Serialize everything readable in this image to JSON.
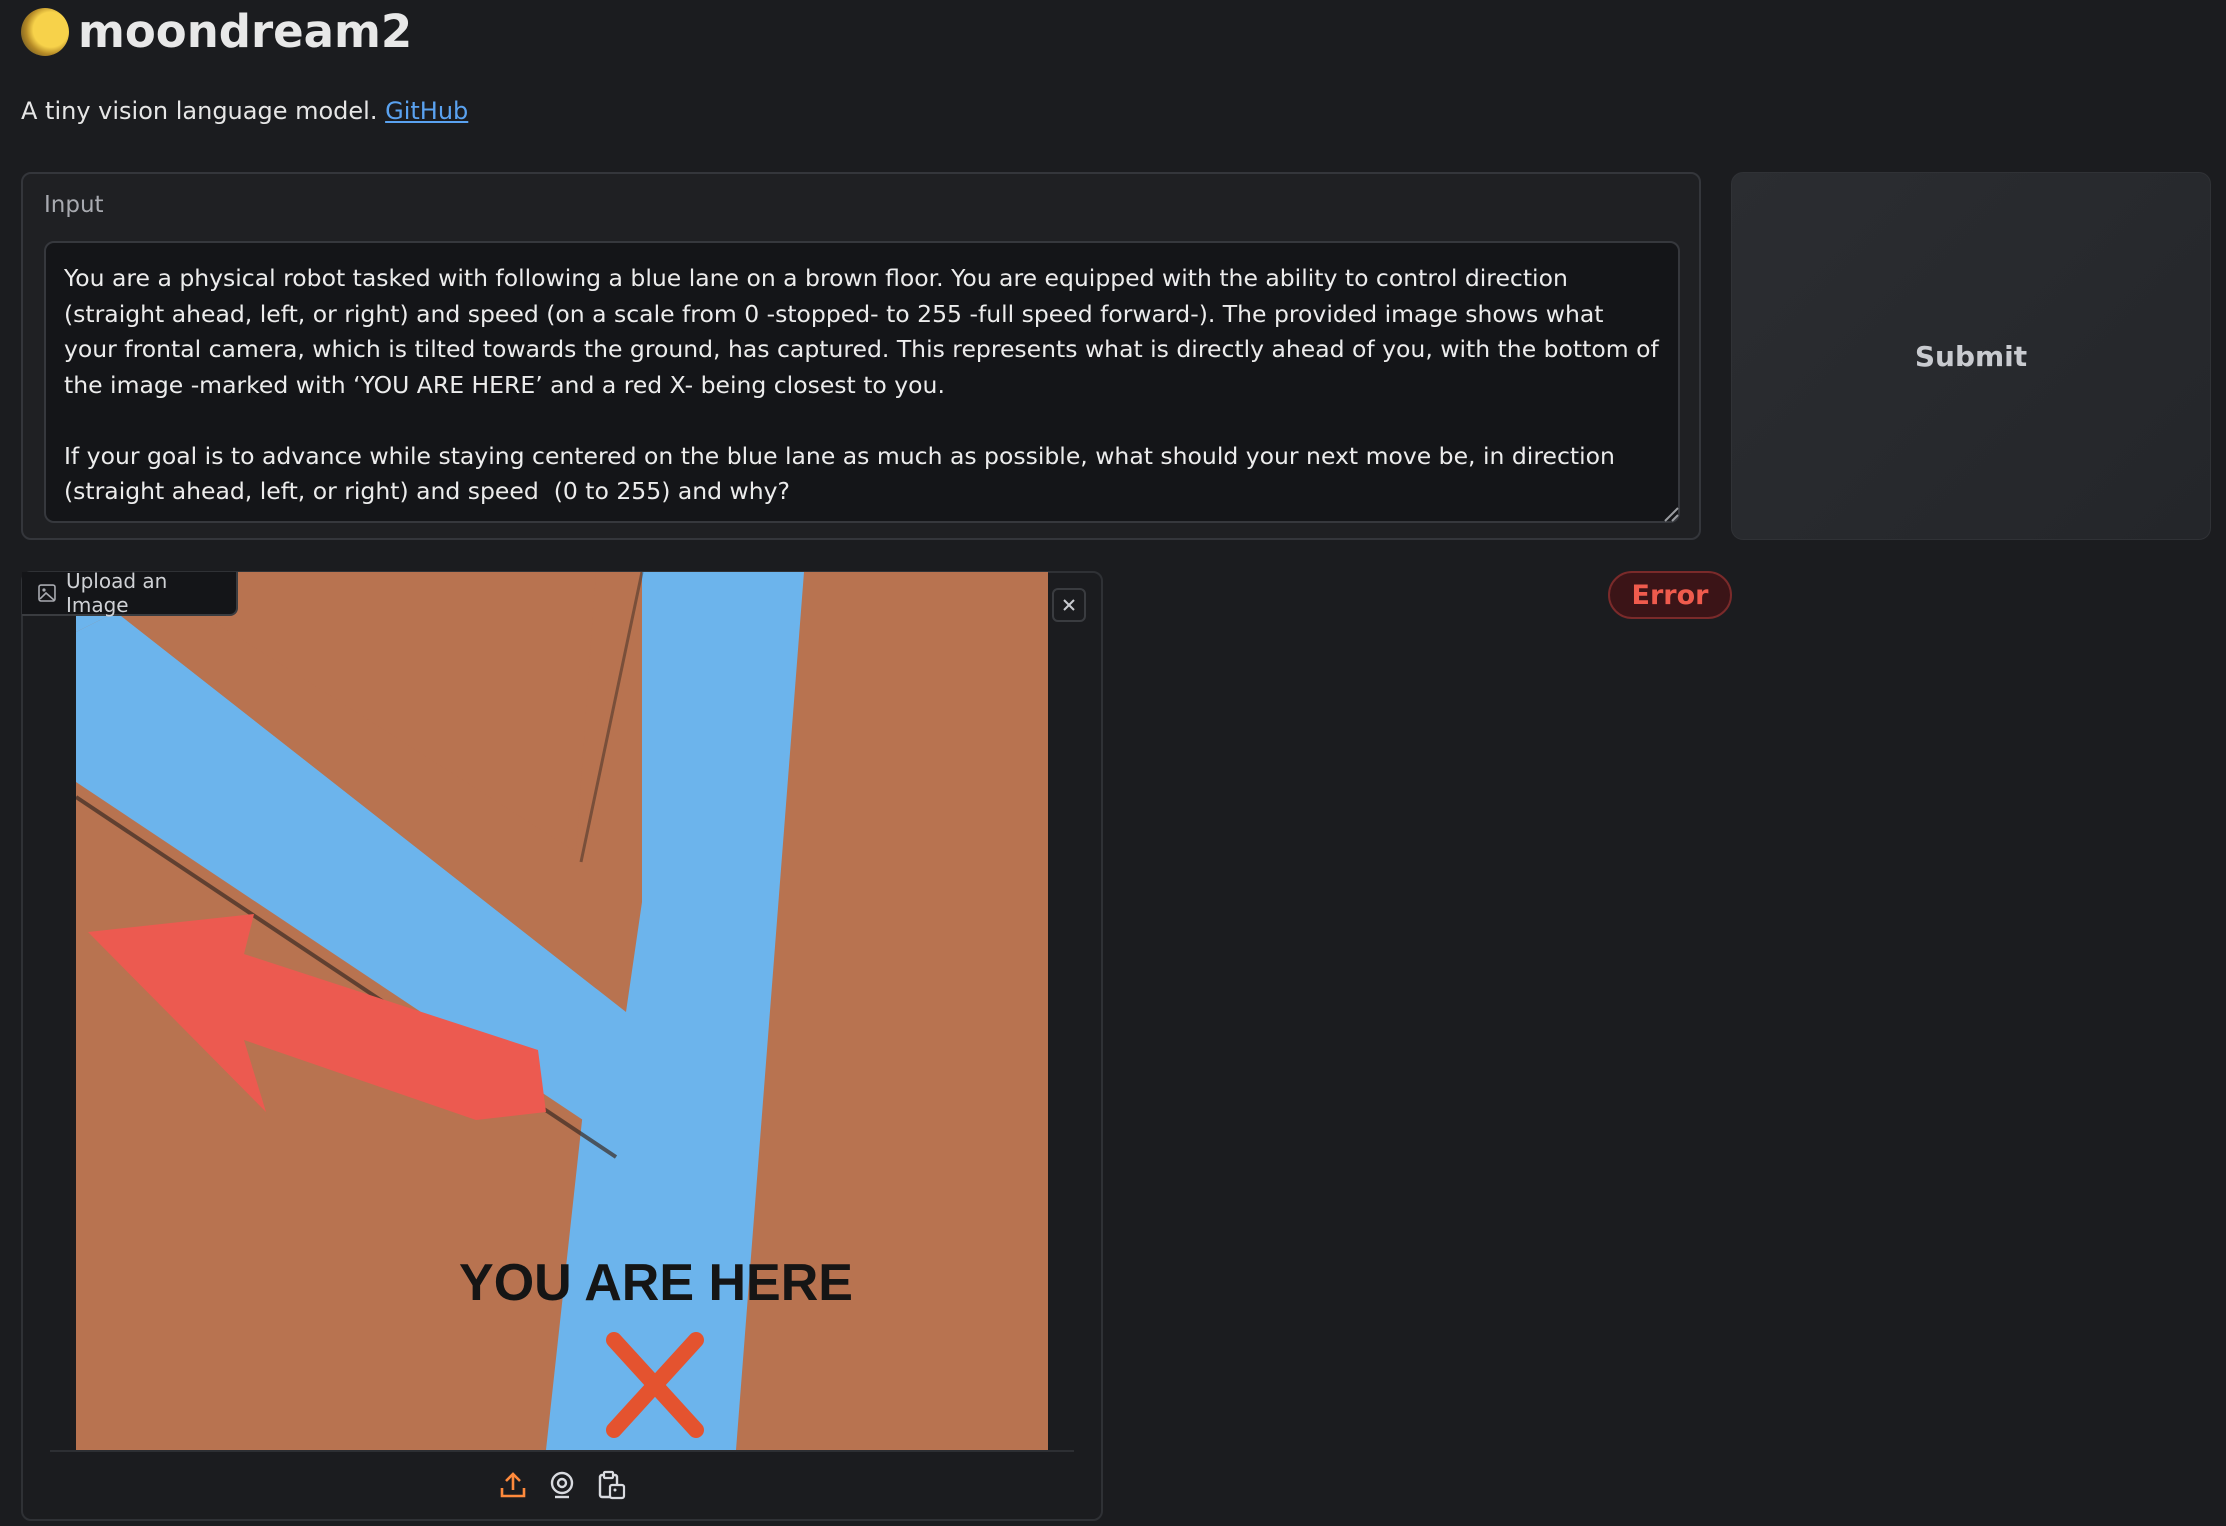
{
  "header": {
    "title": "moondream2",
    "description": "A tiny vision language model.",
    "github_link": "GitHub"
  },
  "input": {
    "label": "Input",
    "prompt_text": "You are a physical robot tasked with following a blue lane on a brown floor. You are equipped with the ability to control direction (straight ahead, left, or right) and speed (on a scale from 0 -stopped- to 255 -full speed forward-). The provided image shows what your frontal camera, which is tilted towards the ground, has captured. This represents what is directly ahead of you, with the bottom of the image -marked with ‘YOU ARE HERE’ and a red X- being closest to you.\n\nIf your goal is to advance while staying centered on the blue lane as much as possible, what should your next move be, in direction (straight ahead, left, or right) and speed  (0 to 255) and why?"
  },
  "submit_label": "Submit",
  "status": {
    "error_label": "Error"
  },
  "image_panel": {
    "tab_label": "Upload an Image",
    "image_text": "YOU ARE HERE",
    "toolbar_icons": [
      "upload-icon",
      "webcam-icon",
      "clipboard-icon"
    ]
  },
  "colors": {
    "background": "#1b1c1f",
    "link": "#5aa2f0",
    "error": "#ef5b4d",
    "floor": "#b87350",
    "lane": "#6cb4ec",
    "arrow": "#ec5a50",
    "toolbar_icon": "#ff8a3c"
  }
}
